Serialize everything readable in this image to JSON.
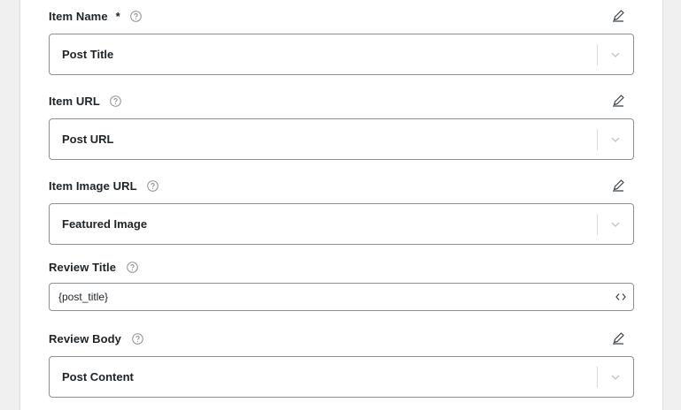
{
  "fields": [
    {
      "label": "Item Name",
      "required_mark": "*",
      "value": "Post Title"
    },
    {
      "label": "Item URL",
      "value": "Post URL"
    },
    {
      "label": "Item Image URL",
      "value": "Featured Image"
    },
    {
      "label": "Review Title",
      "value": "{post_title}"
    },
    {
      "label": "Review Body",
      "value": "Post Content"
    }
  ],
  "icons": {
    "help": "question-circle-icon",
    "edit": "pencil-icon",
    "dropdown": "chevron-down-icon",
    "code": "code-brackets-icon"
  }
}
